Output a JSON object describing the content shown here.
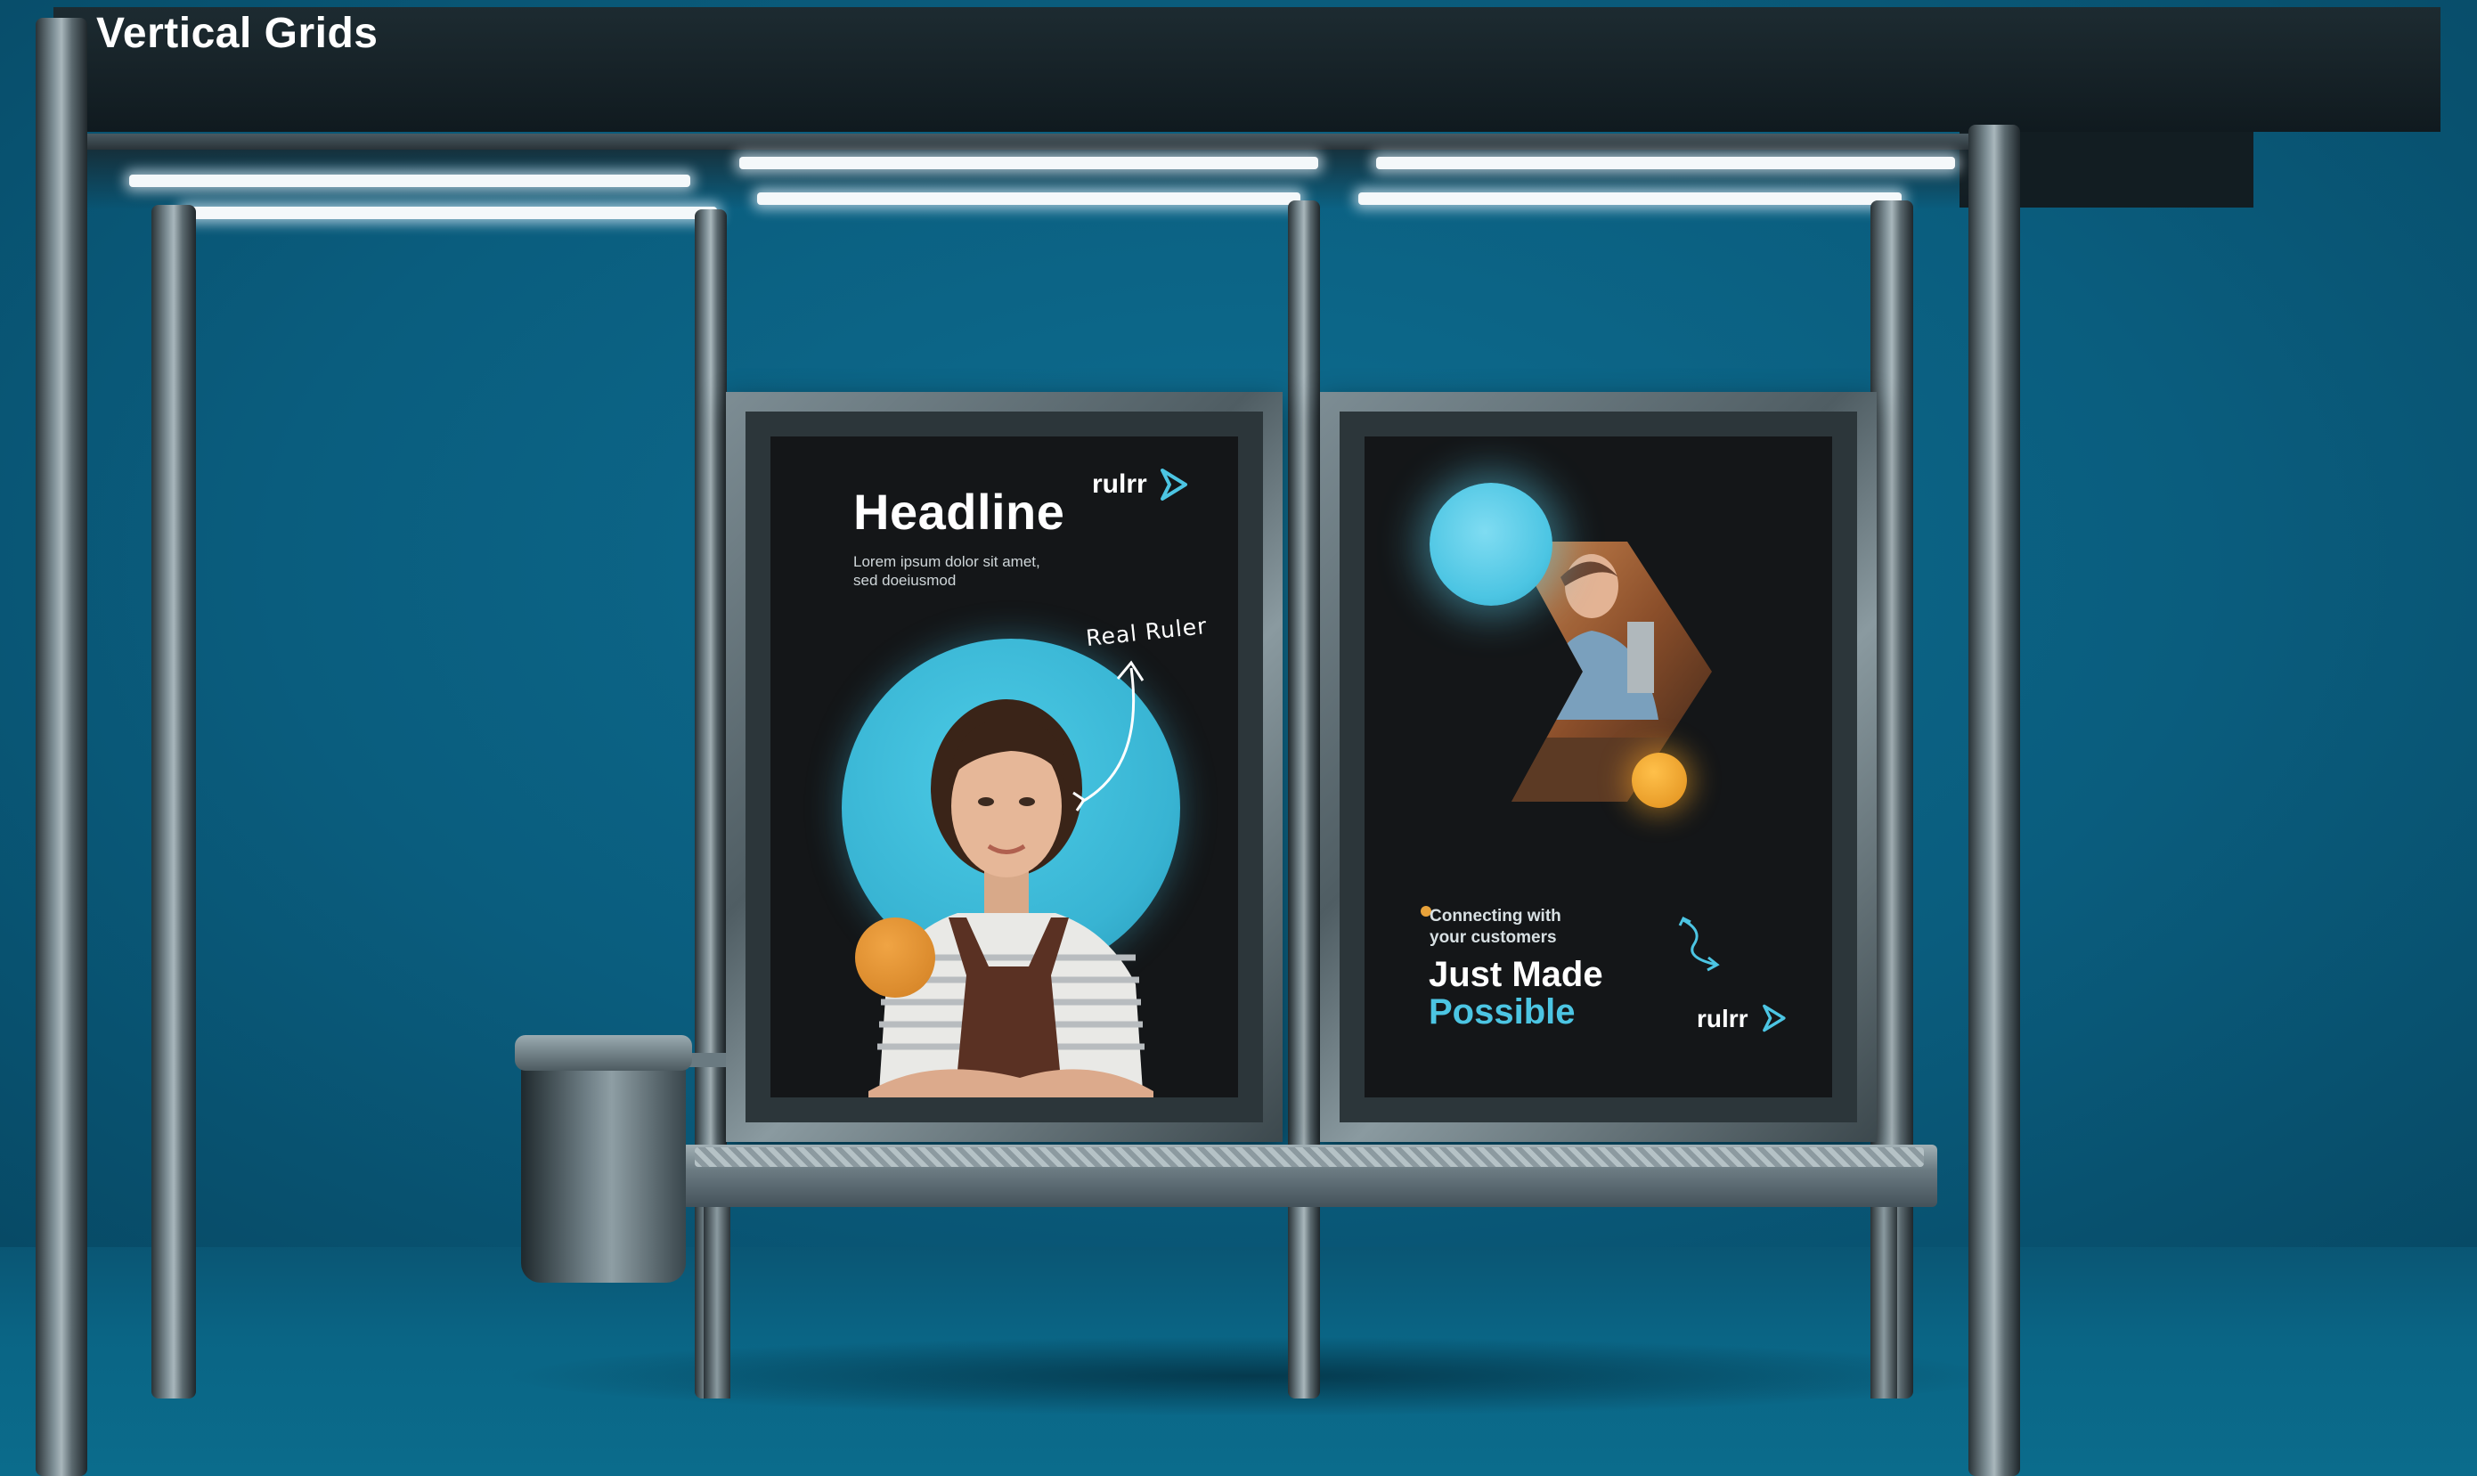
{
  "page": {
    "title": "Vertical Grids"
  },
  "scene": {
    "background_color": "#0b5d7c",
    "structure": "bus-shelter",
    "objects": [
      "roof-lights",
      "poster-frame-left",
      "poster-frame-right",
      "bench",
      "trash-bin",
      "support-poles"
    ]
  },
  "poster_left": {
    "logo_text": "rulrr",
    "headline": "Headline",
    "body_line1": "Lorem ipsum dolor sit amet,",
    "body_line2": "sed doeiusmod",
    "handwritten_note": "Real Ruler",
    "colors": {
      "circle": "#3fbfdc",
      "accent": "#e2922f",
      "background": "#141618"
    }
  },
  "poster_right": {
    "subtext_line1": "Connecting with",
    "subtext_line2": "your customers",
    "headline_line1": "Just Made",
    "headline_line2": "Possible",
    "logo_text": "rulrr",
    "colors": {
      "circle": "#4cc5e3",
      "accent": "#f0a22a",
      "headline_accent": "#4cc5e3"
    }
  }
}
